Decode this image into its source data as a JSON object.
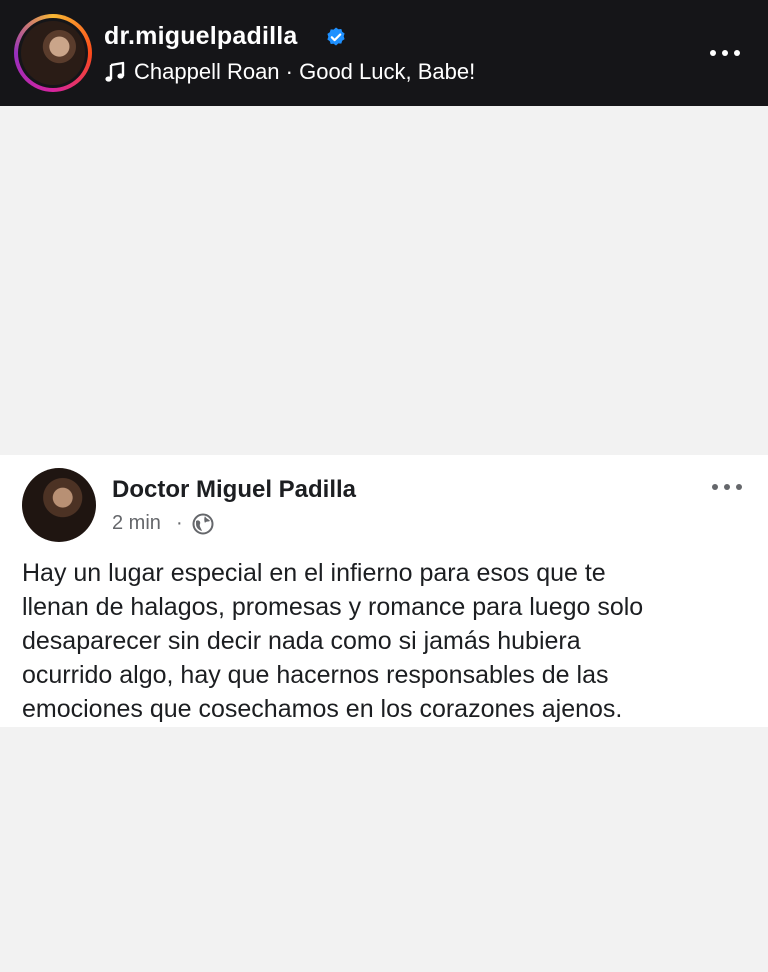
{
  "story": {
    "username": "dr.miguelpadilla",
    "song": "Chappell Roan · Good Luck, Babe!",
    "icons": {
      "verified": "verified-badge-icon",
      "music": "music-note-icon",
      "more": "more-options-icon"
    },
    "colors": {
      "header_bg": "#151518",
      "verified": "#1e90ff"
    }
  },
  "post": {
    "author": "Doctor Miguel Padilla",
    "time": "2 min",
    "separator": "·",
    "text": "Hay un lugar especial en el infierno para esos que te\nllenan de halagos, promesas  y romance para luego solo\ndesaparecer sin decir nada como si jamás hubiera\nocurrido algo, hay que hacernos responsables de las\nemociones que cosechamos en los corazones ajenos.",
    "icons": {
      "audience": "globe-icon",
      "more": "more-options-icon"
    }
  }
}
